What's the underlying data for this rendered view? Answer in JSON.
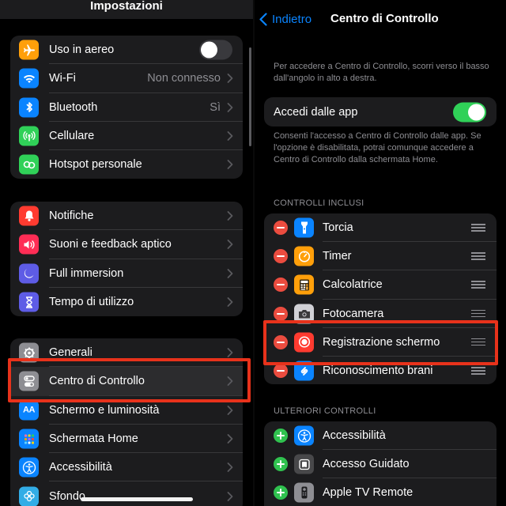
{
  "left": {
    "title": "Impostazioni",
    "group1": [
      {
        "label": "Uso in aereo",
        "icon": "airplane-icon",
        "color": "#ff9f0a",
        "toggle": false
      },
      {
        "label": "Wi-Fi",
        "icon": "wifi-icon",
        "color": "#0a84ff",
        "value": "Non connesso"
      },
      {
        "label": "Bluetooth",
        "icon": "bluetooth-icon",
        "color": "#0a84ff",
        "value": "Sì"
      },
      {
        "label": "Cellulare",
        "icon": "cellular-icon",
        "color": "#30d158"
      },
      {
        "label": "Hotspot personale",
        "icon": "hotspot-icon",
        "color": "#30d158"
      }
    ],
    "group2": [
      {
        "label": "Notifiche",
        "icon": "bell-icon",
        "color": "#ff3b30"
      },
      {
        "label": "Suoni e feedback aptico",
        "icon": "speaker-icon",
        "color": "#ff2d55"
      },
      {
        "label": "Full immersion",
        "icon": "moon-icon",
        "color": "#5e5ce6"
      },
      {
        "label": "Tempo di utilizzo",
        "icon": "hourglass-icon",
        "color": "#5e5ce6"
      }
    ],
    "group3": [
      {
        "label": "Generali",
        "icon": "gear-icon",
        "color": "#8e8e93"
      },
      {
        "label": "Centro di Controllo",
        "icon": "toggles-icon",
        "color": "#8e8e93"
      },
      {
        "label": "Schermo e luminosità",
        "icon": "text-size-icon",
        "color": "#0a84ff"
      },
      {
        "label": "Schermata Home",
        "icon": "home-grid-icon",
        "color": "#0a84ff"
      },
      {
        "label": "Accessibilità",
        "icon": "accessibility-icon",
        "color": "#0a84ff"
      },
      {
        "label": "Sfondo",
        "icon": "flower-icon",
        "color": "#32ade6"
      }
    ]
  },
  "right": {
    "back_label": "Indietro",
    "title": "Centro di Controllo",
    "intro": "Per accedere a Centro di Controllo, scorri verso il basso dall'angolo in alto a destra.",
    "access_label": "Accedi dalle app",
    "access_on": true,
    "access_note": "Consenti l'accesso a Centro di Controllo dalle app. Se l'opzione è disabilitata, potrai comunque accedere a Centro di Controllo dalla schermata Home.",
    "included_header": "CONTROLLI INCLUSI",
    "included": [
      {
        "label": "Torcia",
        "icon": "flashlight-icon",
        "color": "#0a84ff"
      },
      {
        "label": "Timer",
        "icon": "timer-icon",
        "color": "#ff9f0a"
      },
      {
        "label": "Calcolatrice",
        "icon": "calculator-icon",
        "color": "#ff9f0a"
      },
      {
        "label": "Fotocamera",
        "icon": "camera-icon",
        "color": "#8e8e93"
      },
      {
        "label": "Registrazione schermo",
        "icon": "record-icon",
        "color": "#ff3b30"
      },
      {
        "label": "Riconoscimento brani",
        "icon": "shazam-icon",
        "color": "#0a84ff"
      }
    ],
    "more_header": "ULTERIORI CONTROLLI",
    "more": [
      {
        "label": "Accessibilità",
        "icon": "accessibility-icon",
        "color": "#0a84ff"
      },
      {
        "label": "Accesso Guidato",
        "icon": "guided-access-icon",
        "color": "#48484a"
      },
      {
        "label": "Apple TV Remote",
        "icon": "remote-icon",
        "color": "#8e8e93"
      }
    ]
  }
}
